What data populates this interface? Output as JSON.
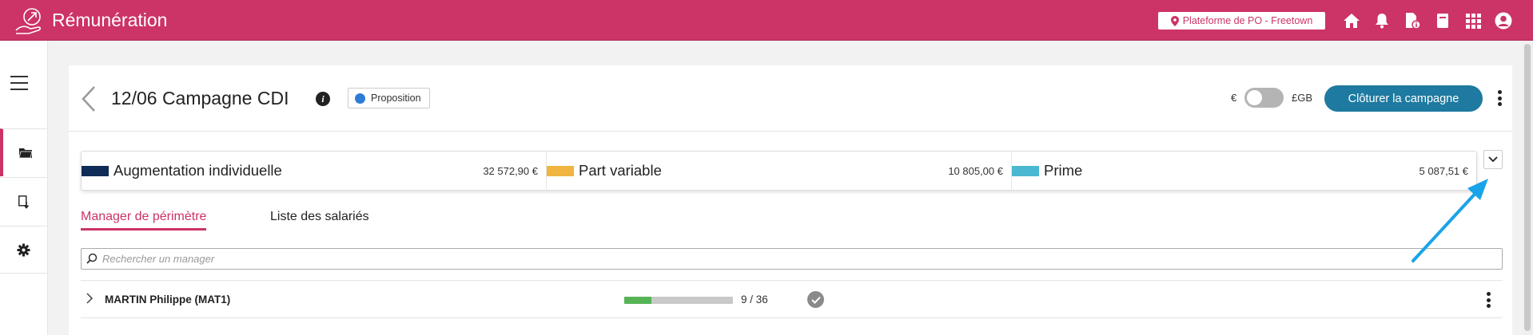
{
  "app": {
    "title": "Rémunération",
    "logo_icon": "hand-with-coin-logo-icon"
  },
  "topbar": {
    "platform_chip": {
      "label": "Plateforme de PO - Freetown",
      "icon": "location-pin-icon"
    },
    "icons": [
      "home-icon",
      "bell-icon",
      "document-info-icon",
      "book-icon",
      "apps-grid-icon",
      "user-avatar-icon"
    ]
  },
  "sidenav": {
    "menu_icon": "hamburger-menu-icon",
    "items": [
      {
        "icon": "folder-icon",
        "active": true
      },
      {
        "icon": "export-document-icon",
        "active": false
      },
      {
        "icon": "settings-gear-icon",
        "active": false
      }
    ]
  },
  "header": {
    "title": "12/06 Campagne CDI",
    "status": "Proposition",
    "status_color": "#2e7bd6",
    "currency_left": "€",
    "currency_right": "£GB",
    "close_button": "Clôturer la campagne"
  },
  "summary": [
    {
      "label": "Augmentation individuelle",
      "amount": "32 572,90 €",
      "color": "#0f2b57"
    },
    {
      "label": "Part variable",
      "amount": "10 805,00 €",
      "color": "#f0b440"
    },
    {
      "label": "Prime",
      "amount": "5 087,51 €",
      "color": "#4ab8d0"
    }
  ],
  "tabs": [
    {
      "label": "Manager de périmètre",
      "active": true
    },
    {
      "label": "Liste des salariés",
      "active": false
    }
  ],
  "search": {
    "placeholder": "Rechercher un manager"
  },
  "rows": [
    {
      "name": "MARTIN Philippe (MAT1)",
      "progress": 0.25,
      "count": "9 / 36",
      "status_icon": "check-circle-icon"
    }
  ],
  "colors": {
    "brand": "#cc3366",
    "primary_button": "#1e7aa0",
    "annotation_arrow": "#1aa3e8"
  }
}
